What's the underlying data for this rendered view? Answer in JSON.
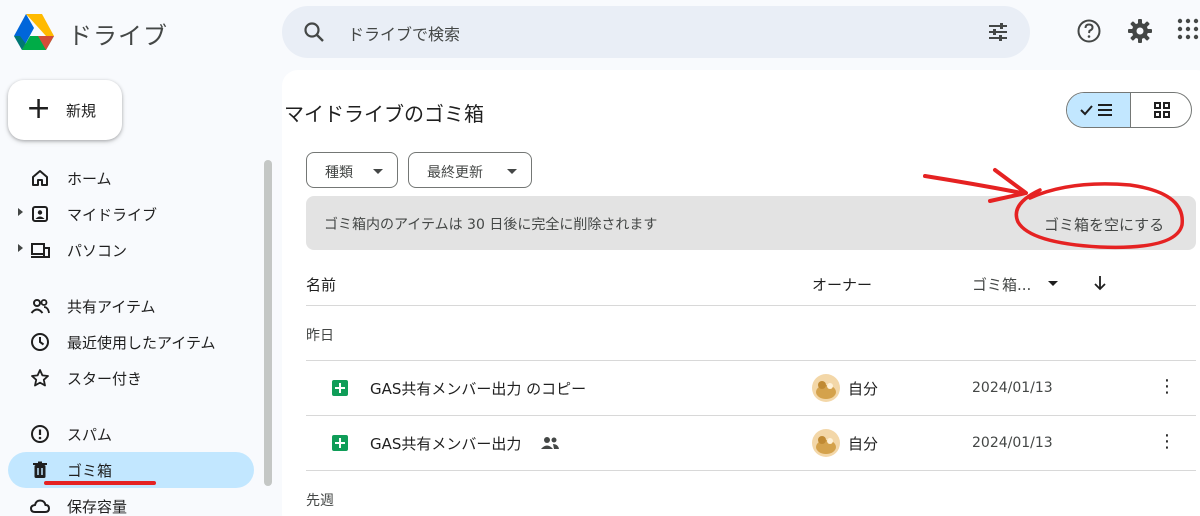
{
  "header": {
    "app_title": "ドライブ",
    "search_placeholder": "ドライブで検索",
    "icons": [
      "drive-logo-icon",
      "search-icon",
      "tune-icon",
      "help-icon",
      "settings-icon",
      "apps-icon"
    ]
  },
  "sidebar": {
    "new_label": "新規",
    "items": [
      {
        "label": "ホーム",
        "icon": "home-icon"
      },
      {
        "label": "マイドライブ",
        "icon": "my-drive-icon"
      },
      {
        "label": "パソコン",
        "icon": "computers-icon"
      },
      {
        "label": "共有アイテム",
        "icon": "shared-icon"
      },
      {
        "label": "最近使用したアイテム",
        "icon": "recent-icon"
      },
      {
        "label": "スター付き",
        "icon": "star-icon"
      },
      {
        "label": "スパム",
        "icon": "spam-icon"
      },
      {
        "label": "ゴミ箱",
        "icon": "trash-icon",
        "active": true
      },
      {
        "label": "保存容量",
        "icon": "cloud-icon"
      }
    ]
  },
  "main": {
    "title": "マイドライブのゴミ箱",
    "filters": [
      "種類",
      "最終更新"
    ],
    "banner_message": "ゴミ箱内のアイテムは 30 日後に完全に削除されます",
    "empty_trash_label": "ゴミ箱を空にする",
    "columns": {
      "name": "名前",
      "owner": "オーナー",
      "trashed": "ゴミ箱..."
    },
    "groups": [
      {
        "label": "昨日",
        "rows": [
          {
            "name": "GAS共有メンバー出力 のコピー",
            "owner": "自分",
            "date": "2024/01/13",
            "shared": false
          },
          {
            "name": "GAS共有メンバー出力",
            "owner": "自分",
            "date": "2024/01/13",
            "shared": true
          }
        ]
      },
      {
        "label": "先週",
        "rows": []
      }
    ]
  },
  "colors": {
    "accent": "#c2e7ff",
    "annotation": "#e52222",
    "sheets": "#0f9d58"
  }
}
